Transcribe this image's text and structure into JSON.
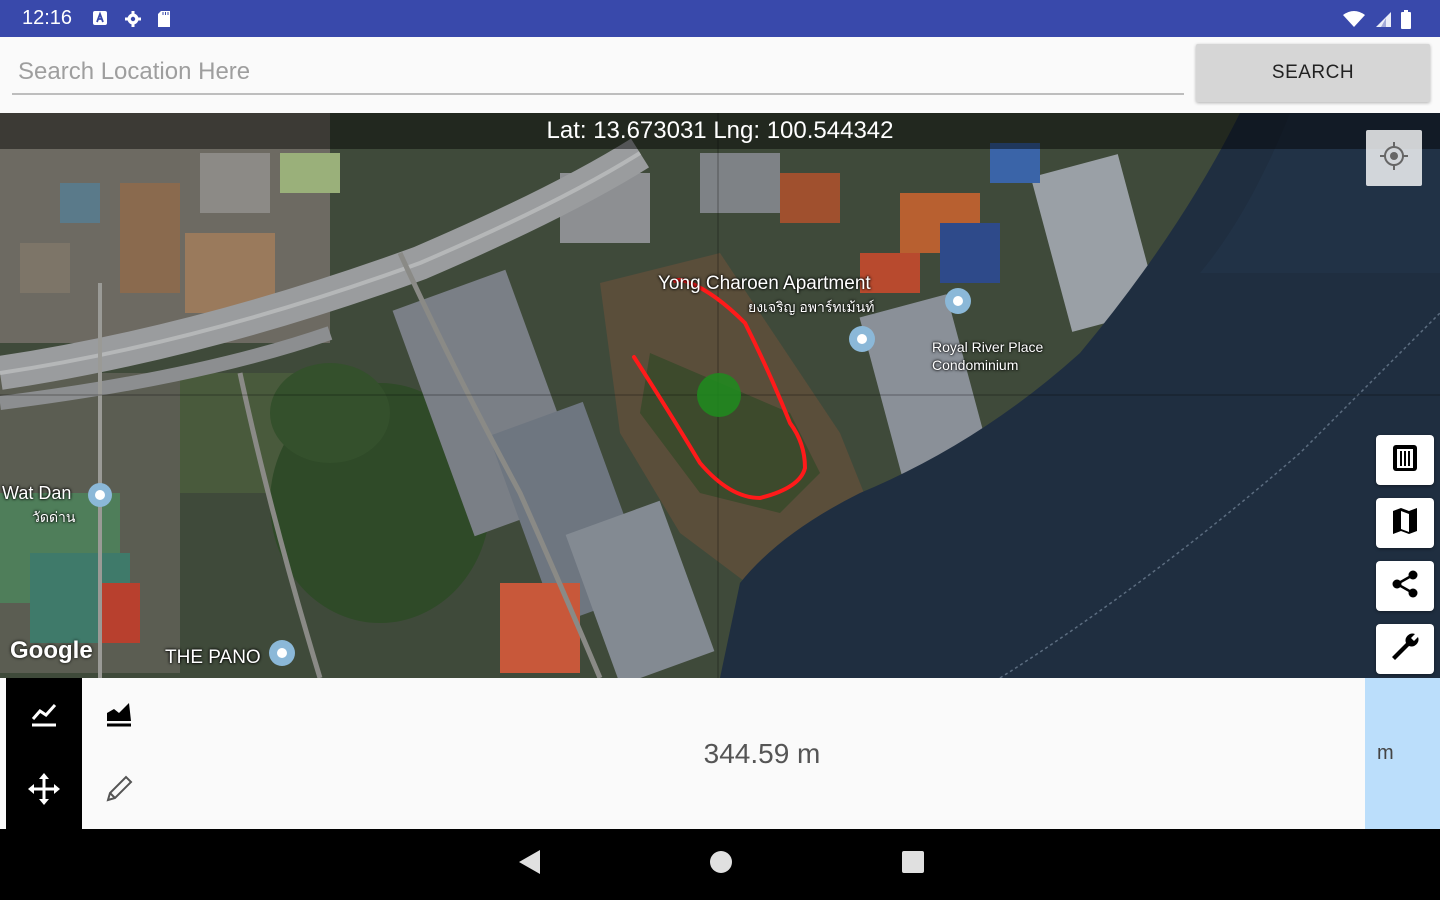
{
  "status_bar": {
    "time": "12:16",
    "left_icons": [
      "a-icon",
      "gear-icon",
      "sd-card-icon"
    ],
    "right_icons": [
      "wifi-icon",
      "signal-icon",
      "battery-icon"
    ]
  },
  "search": {
    "placeholder": "Search Location Here",
    "value": "",
    "button_label": "SEARCH"
  },
  "map": {
    "coordinates": "Lat: 13.673031 Lng: 100.544342",
    "provider_logo": "Google",
    "labels": {
      "apartment": "Yong Charoen Apartment",
      "apartment_thai": "ยงเจริญ อพาร์ทเม้นท์",
      "condo_line1": "Royal River Place",
      "condo_line2": "Condominium",
      "temple_line1": "Wat Dan",
      "temple_line2": "วัดด่าน",
      "pano": "THE PANO"
    },
    "measured_path_color": "#ff1a1a",
    "marker_color": "#1e8c1e"
  },
  "map_tools": {
    "my_location": "my-location-icon",
    "delete": "trash-icon",
    "map_type": "map-icon",
    "share": "share-icon",
    "settings": "wrench-icon"
  },
  "bottom_panel": {
    "mode_icons": [
      "distance-icon",
      "move-icon"
    ],
    "tool_icons": [
      "area-icon",
      "pencil-icon"
    ],
    "measurement": "344.59 m",
    "unit": "m",
    "unit_bg": "#bbdefb"
  },
  "nav_bar": {
    "buttons": [
      "back-icon",
      "home-icon",
      "recents-icon"
    ]
  }
}
